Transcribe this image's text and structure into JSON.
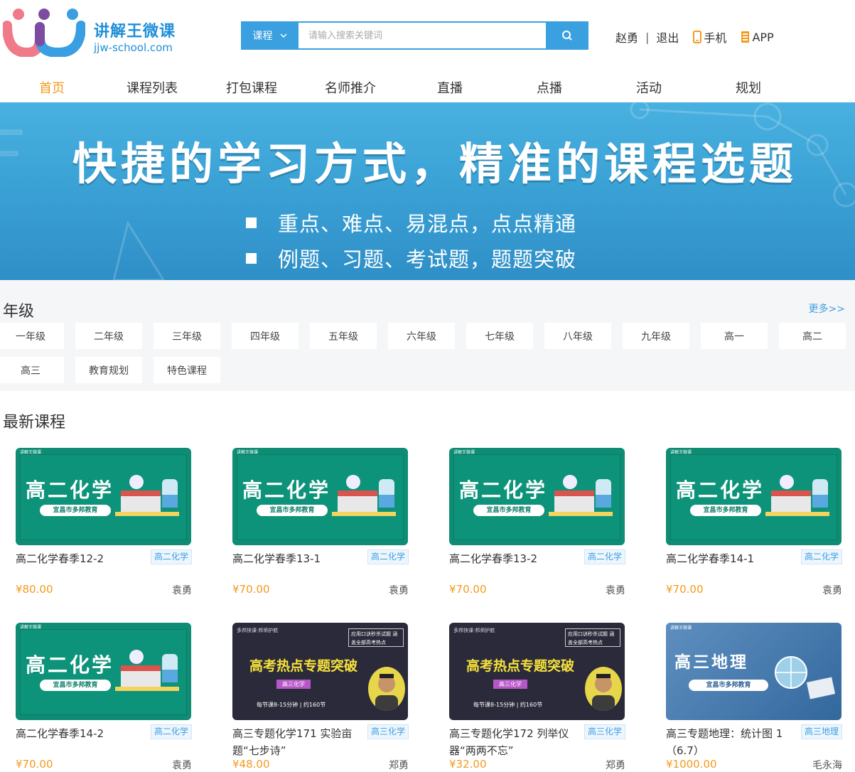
{
  "logo": {
    "name_cn": "讲解王微课",
    "domain": "jjw-school.com"
  },
  "search": {
    "category": "课程",
    "placeholder": "请输入搜索关键词"
  },
  "user": {
    "name": "赵勇",
    "divider": "|",
    "logout": "退出",
    "mobile": "手机",
    "app": "APP"
  },
  "nav": [
    "首页",
    "课程列表",
    "打包课程",
    "名师推介",
    "直播",
    "点播",
    "活动",
    "规划"
  ],
  "banner": {
    "title": "快捷的学习方式，精准的课程选题",
    "line1": "重点、难点、易混点，点点精通",
    "line2": "例题、习题、考试题，题题突破"
  },
  "grades": {
    "title": "年级",
    "more": "更多>>",
    "items": [
      "一年级",
      "二年级",
      "三年级",
      "四年级",
      "五年级",
      "六年级",
      "七年级",
      "八年级",
      "九年级",
      "高一",
      "高二",
      "高三",
      "教育规划",
      "特色课程"
    ]
  },
  "latest": {
    "title": "最新课程",
    "courses": [
      {
        "title": "高二化学春季12-2",
        "tag": "高二化学",
        "price": "¥80.00",
        "teacher": "袁勇",
        "thumb": "green",
        "thumb_title": "高二化学",
        "thumb_sub": "宜昌市多邦教育"
      },
      {
        "title": "高二化学春季13-1",
        "tag": "高二化学",
        "price": "¥70.00",
        "teacher": "袁勇",
        "thumb": "green",
        "thumb_title": "高二化学",
        "thumb_sub": "宜昌市多邦教育"
      },
      {
        "title": "高二化学春季13-2",
        "tag": "高二化学",
        "price": "¥70.00",
        "teacher": "袁勇",
        "thumb": "green",
        "thumb_title": "高二化学",
        "thumb_sub": "宜昌市多邦教育"
      },
      {
        "title": "高二化学春季14-1",
        "tag": "高二化学",
        "price": "¥70.00",
        "teacher": "袁勇",
        "thumb": "green",
        "thumb_title": "高二化学",
        "thumb_sub": "宜昌市多邦教育"
      },
      {
        "title": "高二化学春季14-2",
        "tag": "高二化学",
        "price": "¥70.00",
        "teacher": "袁勇",
        "thumb": "green",
        "thumb_title": "高二化学",
        "thumb_sub": "宜昌市多邦教育"
      },
      {
        "title": "高三专题化学171 实验亩题“七步诗”",
        "tag": "高三化学",
        "price": "¥48.00",
        "teacher": "郑勇",
        "thumb": "dark",
        "thumb_title": "高考热点专题突破",
        "thumb_sub": "高三化学",
        "thumb_top": "多邦快课·邦师护航",
        "thumb_box": "应用口诀秒杀试题 涵盖全部高考热点",
        "thumb_bottom": "每节课8-15分钟 | 约160节"
      },
      {
        "title": "高三专题化学172 列举仪器“两两不忘”",
        "tag": "高三化学",
        "price": "¥32.00",
        "teacher": "郑勇",
        "thumb": "dark",
        "thumb_title": "高考热点专题突破",
        "thumb_sub": "高三化学",
        "thumb_top": "多邦快课·邦师护航",
        "thumb_box": "应用口诀秒杀试题 涵盖全部高考热点",
        "thumb_bottom": "每节课8-15分钟 | 约160节"
      },
      {
        "title": "高三专题地理：统计图 1（6.7）",
        "tag": "高三地理",
        "price": "¥1000.00",
        "teacher": "毛永海",
        "thumb": "blue",
        "thumb_title": "高三地理",
        "thumb_sub": "宜昌市多邦教育"
      }
    ]
  },
  "colors": {
    "accent": "#f39a1e",
    "brand_blue": "#3ba0e0",
    "green_thumb": "#0d9379"
  }
}
